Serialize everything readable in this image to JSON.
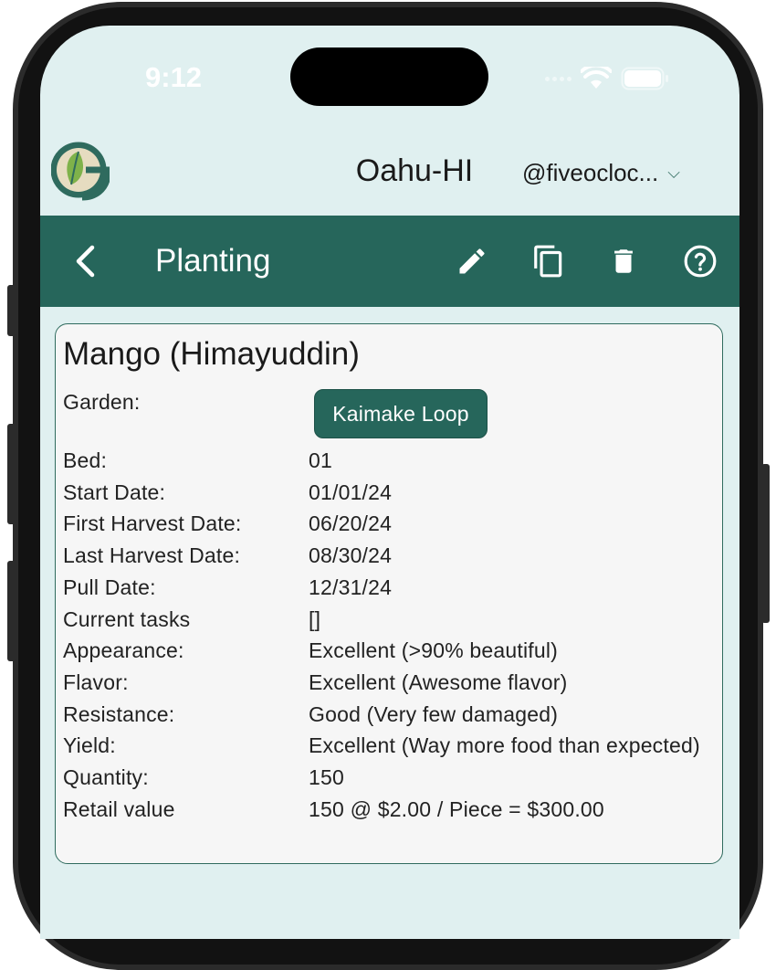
{
  "status_bar": {
    "time": "9:12"
  },
  "header": {
    "location": "Oahu-HI",
    "user": "@fiveocloc...",
    "user_chevron_icon": "chevron-down-icon"
  },
  "toolbar": {
    "title": "Planting",
    "back_icon": "chevron-left-icon",
    "actions": [
      "pencil-icon",
      "copy-icon",
      "trash-icon",
      "help-circle-icon"
    ],
    "background": "#26665b"
  },
  "planting": {
    "name": "Mango (Himayuddin)",
    "garden_label": "Garden:",
    "garden_button": "Kaimake Loop",
    "fields": [
      {
        "label": "Bed:",
        "value": "01"
      },
      {
        "label": "Start Date:",
        "value": "01/01/24"
      },
      {
        "label": "First Harvest Date:",
        "value": "06/20/24"
      },
      {
        "label": "Last Harvest Date:",
        "value": "08/30/24"
      },
      {
        "label": "Pull Date:",
        "value": "12/31/24"
      },
      {
        "label": "Current tasks",
        "value": "[]"
      },
      {
        "label": "Appearance:",
        "value": "Excellent (>90% beautiful)"
      },
      {
        "label": "Flavor:",
        "value": "Excellent (Awesome flavor)"
      },
      {
        "label": "Resistance:",
        "value": "Good (Very few damaged)"
      },
      {
        "label": "Yield:",
        "value": "Excellent (Way more food than expected)"
      },
      {
        "label": "Quantity:",
        "value": "150"
      },
      {
        "label": "Retail value",
        "value": "150 @ $2.00 / Piece  = $300.00"
      }
    ]
  },
  "colors": {
    "screen_bg": "#e0f0f0",
    "accent": "#26665b",
    "card_bg": "#f6f6f6"
  }
}
